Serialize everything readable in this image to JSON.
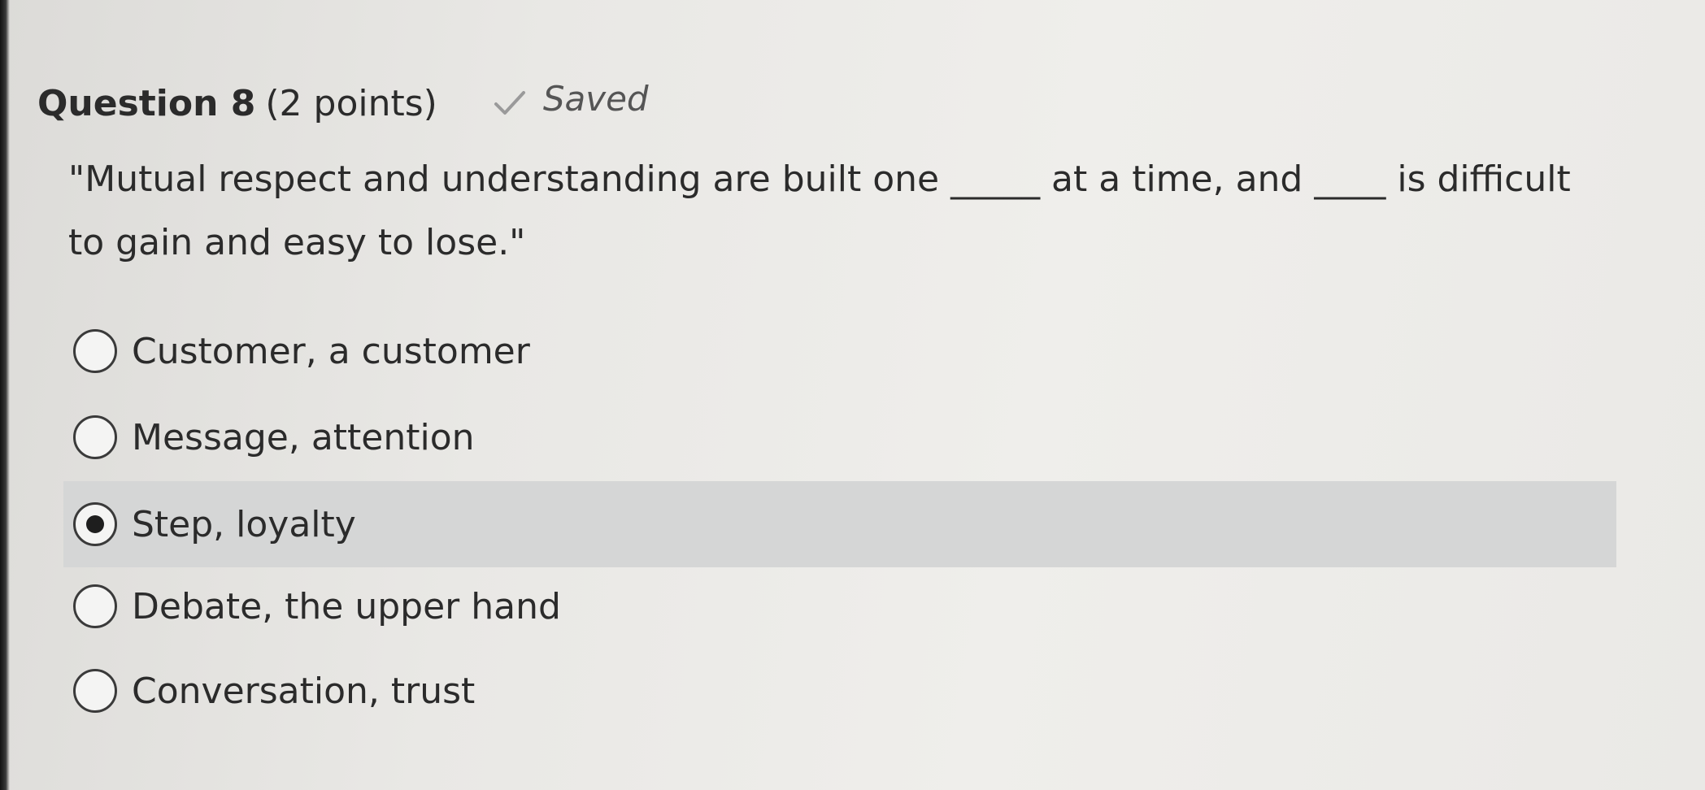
{
  "question": {
    "title": "Question 8",
    "points": "(2 points)",
    "status_icon": "checkmark-icon",
    "status": "Saved",
    "line1": "\"Mutual respect and understanding are built one _____ at a time, and ____ is difficult",
    "line2": "to gain and easy to lose.\""
  },
  "options": [
    {
      "label": "Customer, a customer",
      "selected": false
    },
    {
      "label": "Message, attention",
      "selected": false
    },
    {
      "label": "Step, loyalty",
      "selected": true
    },
    {
      "label": "Debate, the upper hand",
      "selected": false
    },
    {
      "label": "Conversation, trust",
      "selected": false
    }
  ],
  "colors": {
    "selected_row": "#d5d6d6",
    "text": "#2b2b2b",
    "saved_text": "#555555",
    "check": "#9a9a9a"
  }
}
